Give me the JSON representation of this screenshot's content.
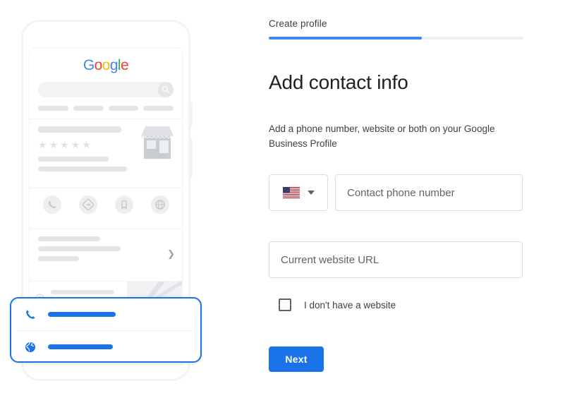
{
  "step": {
    "label": "Create profile",
    "progress_percent": 60,
    "fill_color": "#4285f4",
    "track_color": "#eceff3"
  },
  "headline": "Add contact info",
  "subtext": "Add a phone number, website or both on your Google Business Profile",
  "form": {
    "country": {
      "name": "country-code-select",
      "flag": "us-flag-icon",
      "caret": "chevron-down-icon"
    },
    "phone": {
      "placeholder": "Contact phone number",
      "value": ""
    },
    "website": {
      "placeholder": "Current website URL",
      "value": ""
    },
    "no_website_checkbox": {
      "label": "I don't have a website",
      "checked": false
    }
  },
  "next_button": {
    "label": "Next",
    "color": "#1a73e8"
  },
  "illustration": {
    "phone_mock": {
      "google_logo": [
        "G",
        "o",
        "o",
        "g",
        "l",
        "e"
      ],
      "search_icon": "search-icon",
      "stars_count": 5,
      "storefront": "storefront-icon",
      "chevron": "chevron-right-icon",
      "action_icons": [
        "phone-icon",
        "directions-icon",
        "bookmark-icon",
        "globe-icon"
      ],
      "location_icon": "location-pin-icon",
      "map_pin_icon": "map-pin-icon",
      "clock_icon": "clock-icon"
    },
    "highlight_card": {
      "border_color": "#1a73e8",
      "rows": [
        {
          "icon": "phone-icon",
          "bar_color": "#1a73e8"
        },
        {
          "icon": "globe-icon",
          "bar_color": "#1a73e8"
        }
      ]
    }
  }
}
